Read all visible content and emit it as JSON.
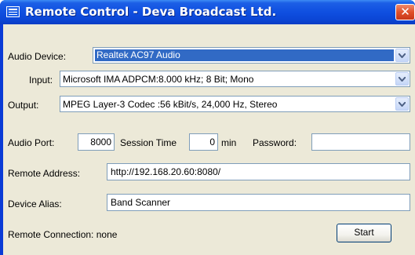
{
  "window": {
    "title": "Remote Control - Deva Broadcast Ltd.",
    "close_glyph": "✕"
  },
  "audio_device": {
    "label": "Audio Device:",
    "value": "Realtek AC97 Audio"
  },
  "input": {
    "label": "Input:",
    "value": "Microsoft IMA ADPCM:8.000 kHz; 8 Bit; Mono"
  },
  "output": {
    "label": "Output:",
    "value": "MPEG Layer-3 Codec :56 kBit/s, 24,000 Hz, Stereo"
  },
  "audio_port": {
    "label": "Audio Port:",
    "value": "8000"
  },
  "session_time": {
    "label": "Session Time",
    "value": "0",
    "unit": "min"
  },
  "password": {
    "label": "Password:",
    "value": ""
  },
  "remote_address": {
    "label": "Remote Address:",
    "value": "http://192.168.20.60:8080/"
  },
  "device_alias": {
    "label": "Device Alias:",
    "value": "Band Scanner"
  },
  "status": {
    "text": "Remote Connection: none"
  },
  "start_button": {
    "label": "Start"
  },
  "icons": [
    "app-window-icon",
    "close-icon",
    "chevron-down-icon"
  ]
}
